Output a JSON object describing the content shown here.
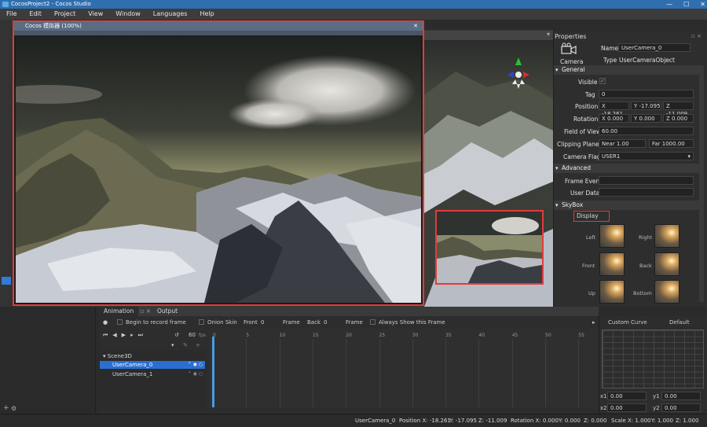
{
  "window": {
    "title": "CocosProject2 - Cocos Studio",
    "minimize": "—",
    "maximize": "☐",
    "close": "✕"
  },
  "menu": [
    "File",
    "Edit",
    "Project",
    "View",
    "Window",
    "Languages",
    "Help"
  ],
  "simulator": {
    "title": "Cocos 模拟器 (100%)",
    "close": "✕"
  },
  "properties": {
    "panel_title": "Properties",
    "component_label": "Camera",
    "name_label": "Name",
    "name_value": "UserCamera_0",
    "type_label": "Type",
    "type_value": "UserCameraObject",
    "general_header": "General",
    "visible_label": "Visible",
    "visible_check": "✓",
    "tag_label": "Tag",
    "tag_value": "0",
    "position_label": "Position",
    "pos_x": "X -18.261",
    "pos_y": "Y -17.095",
    "pos_z": "Z -11.009",
    "rotation_label": "Rotation",
    "rot_x": "X 0.000",
    "rot_y": "Y 0.000",
    "rot_z": "Z 0.000",
    "fov_label": "Field of View",
    "fov_value": "60.00",
    "clip_label": "Clipping Planes",
    "near": "Near 1.00",
    "far": "Far 1000.00",
    "flag_label": "Camera Flag",
    "flag_value": "USER1",
    "advanced_header": "Advanced",
    "frame_event_label": "Frame Event",
    "user_data_label": "User Data",
    "skybox_header": "SkyBox",
    "display_label": "Display",
    "sky_left": "Left",
    "sky_right": "Right",
    "sky_front": "Front",
    "sky_back": "Back",
    "sky_up": "Up",
    "sky_bottom": "Bottom"
  },
  "animation": {
    "tab_animation": "Animation",
    "tab_output": "Output",
    "record_label": "Begin to record frame",
    "onion_label": "Onion Skin",
    "front_label": "Front",
    "front_value": "0",
    "frame_label1": "Frame",
    "back_label": "Back",
    "back_value": "0",
    "frame_label2": "Frame",
    "always_label": "Always Show this Frame",
    "fps_value": "60",
    "fps_unit": "fps",
    "ticks": [
      "0",
      "5",
      "10",
      "15",
      "20",
      "25",
      "30",
      "35",
      "40",
      "45",
      "50",
      "55"
    ],
    "tree": [
      "Scene3D",
      "UserCamera_0",
      "UserCamera_1"
    ]
  },
  "curve": {
    "title": "Custom Curve",
    "preset": "Default",
    "x1": "x1",
    "x1v": "0.00",
    "y1": "y1",
    "y1v": "0.00",
    "x2": "x2",
    "x2v": "0.00",
    "y2": "y2",
    "y2v": "0.00"
  },
  "status": {
    "object": "UserCamera_0",
    "position": "Position X: -18.261",
    "pos_y": "Y: -17.095",
    "pos_z": "Z: -11.009",
    "rotation": "Rotation X: 0.000",
    "rot_y": "Y: 0.000",
    "rot_z": "Z: 0.000",
    "scale": "Scale X: 1.000",
    "scale_y": "Y: 1.000",
    "scale_z": "Z: 1.000"
  }
}
